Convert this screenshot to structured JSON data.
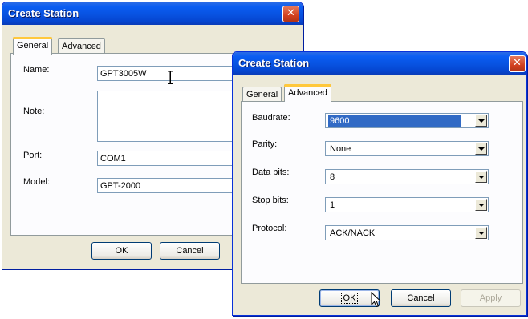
{
  "dialog1": {
    "title": "Create Station",
    "tabs": [
      {
        "label": "General"
      },
      {
        "label": "Advanced"
      }
    ],
    "fields": {
      "name_label": "Name:",
      "name_value": "GPT3005W",
      "note_label": "Note:",
      "note_value": "",
      "port_label": "Port:",
      "port_value": "COM1",
      "model_label": "Model:",
      "model_value": "GPT-2000"
    },
    "buttons": {
      "ok": "OK",
      "cancel": "Cancel"
    }
  },
  "dialog2": {
    "title": "Create Station",
    "tabs": [
      {
        "label": "General"
      },
      {
        "label": "Advanced"
      }
    ],
    "fields": {
      "baudrate_label": "Baudrate:",
      "baudrate_value": "9600",
      "parity_label": "Parity:",
      "parity_value": "None",
      "databits_label": "Data bits:",
      "databits_value": "8",
      "stopbits_label": "Stop bits:",
      "stopbits_value": "1",
      "protocol_label": "Protocol:",
      "protocol_value": "ACK/NACK"
    },
    "buttons": {
      "ok": "OK",
      "cancel": "Cancel",
      "apply": "Apply"
    }
  },
  "icons": {
    "close": "close-icon",
    "dropdown": "chevron-down-icon",
    "ibeam": "text-cursor-icon",
    "pointer": "mouse-pointer-icon"
  },
  "colors": {
    "titlebar": "#0a5df2",
    "dialog_bg": "#ece9d8",
    "close": "#d2401f",
    "selection": "#316ac5",
    "active_tab": "#ffc83c"
  }
}
